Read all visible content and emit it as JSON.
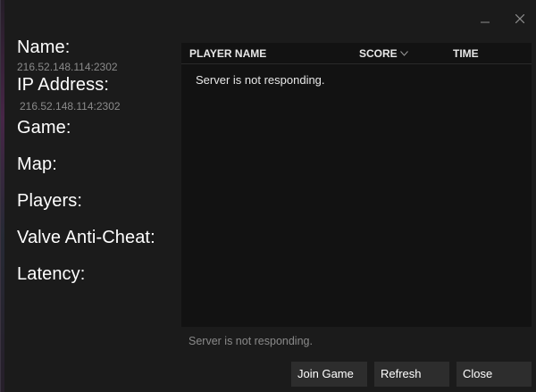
{
  "window": {
    "minimize_icon": "minimize-icon",
    "close_icon": "close-icon"
  },
  "server_info": {
    "name_label": "Name:",
    "name_value": "216.52.148.114:2302",
    "ip_label": "IP Address:",
    "ip_value": "216.52.148.114:2302",
    "game_label": "Game:",
    "map_label": "Map:",
    "players_label": "Players:",
    "vac_label": "Valve Anti-Cheat:",
    "latency_label": "Latency:"
  },
  "players_table": {
    "columns": [
      "PLAYER NAME",
      "SCORE",
      "TIME"
    ],
    "sort_column": "SCORE",
    "sort_icon": "chevron-down-icon",
    "empty_message": "Server is not responding."
  },
  "status": {
    "text": "Server is not responding."
  },
  "buttons": {
    "join": "Join Game",
    "refresh": "Refresh",
    "close": "Close"
  },
  "colors": {
    "background": "#1b1b1b",
    "panel": "#121212",
    "button": "#2d2d2d",
    "muted_text": "#8a8a8a"
  }
}
